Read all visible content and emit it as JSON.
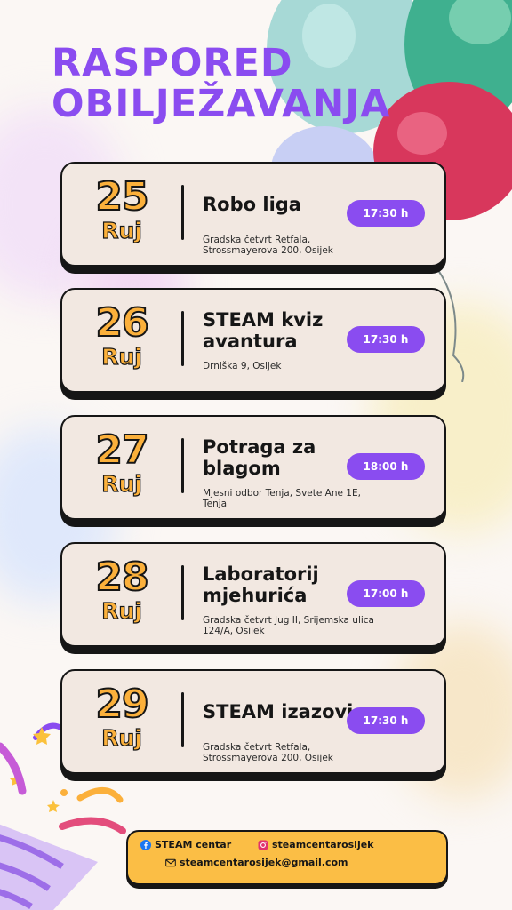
{
  "title": {
    "line1": "RASPORED",
    "line2": "OBILJEŽAVANJA"
  },
  "colors": {
    "accent": "#8a4cf0",
    "date": "#fbb03b",
    "footer": "#fbbe45",
    "card": "#f2e8e1",
    "ink": "#161616"
  },
  "events": [
    {
      "day": "25",
      "month": "Ruj",
      "name": "Robo liga",
      "location": "Gradska četvrt Retfala, Strossmayerova 200, Osijek",
      "time": "17:30 h"
    },
    {
      "day": "26",
      "month": "Ruj",
      "name": "STEAM kviz avantura",
      "location": "Drniška 9, Osijek",
      "time": "17:30 h"
    },
    {
      "day": "27",
      "month": "Ruj",
      "name": "Potraga za blagom",
      "location": "Mjesni odbor Tenja, Svete Ane 1E, Tenja",
      "time": "18:00 h"
    },
    {
      "day": "28",
      "month": "Ruj",
      "name": "Laboratorij mjehurića",
      "location": "Gradska četvrt Jug II, Srijemska ulica 124/A, Osijek",
      "time": "17:00 h"
    },
    {
      "day": "29",
      "month": "Ruj",
      "name": "STEAM izazovi",
      "location": "Gradska četvrt Retfala, Strossmayerova 200, Osijek",
      "time": "17:30 h"
    }
  ],
  "footer": {
    "facebook": {
      "icon": "facebook-icon",
      "label": "STEAM centar"
    },
    "instagram": {
      "icon": "instagram-icon",
      "label": "steamcentarosijek"
    },
    "email": {
      "icon": "mail-icon",
      "label": "steamcentarosijek@gmail.com"
    }
  }
}
